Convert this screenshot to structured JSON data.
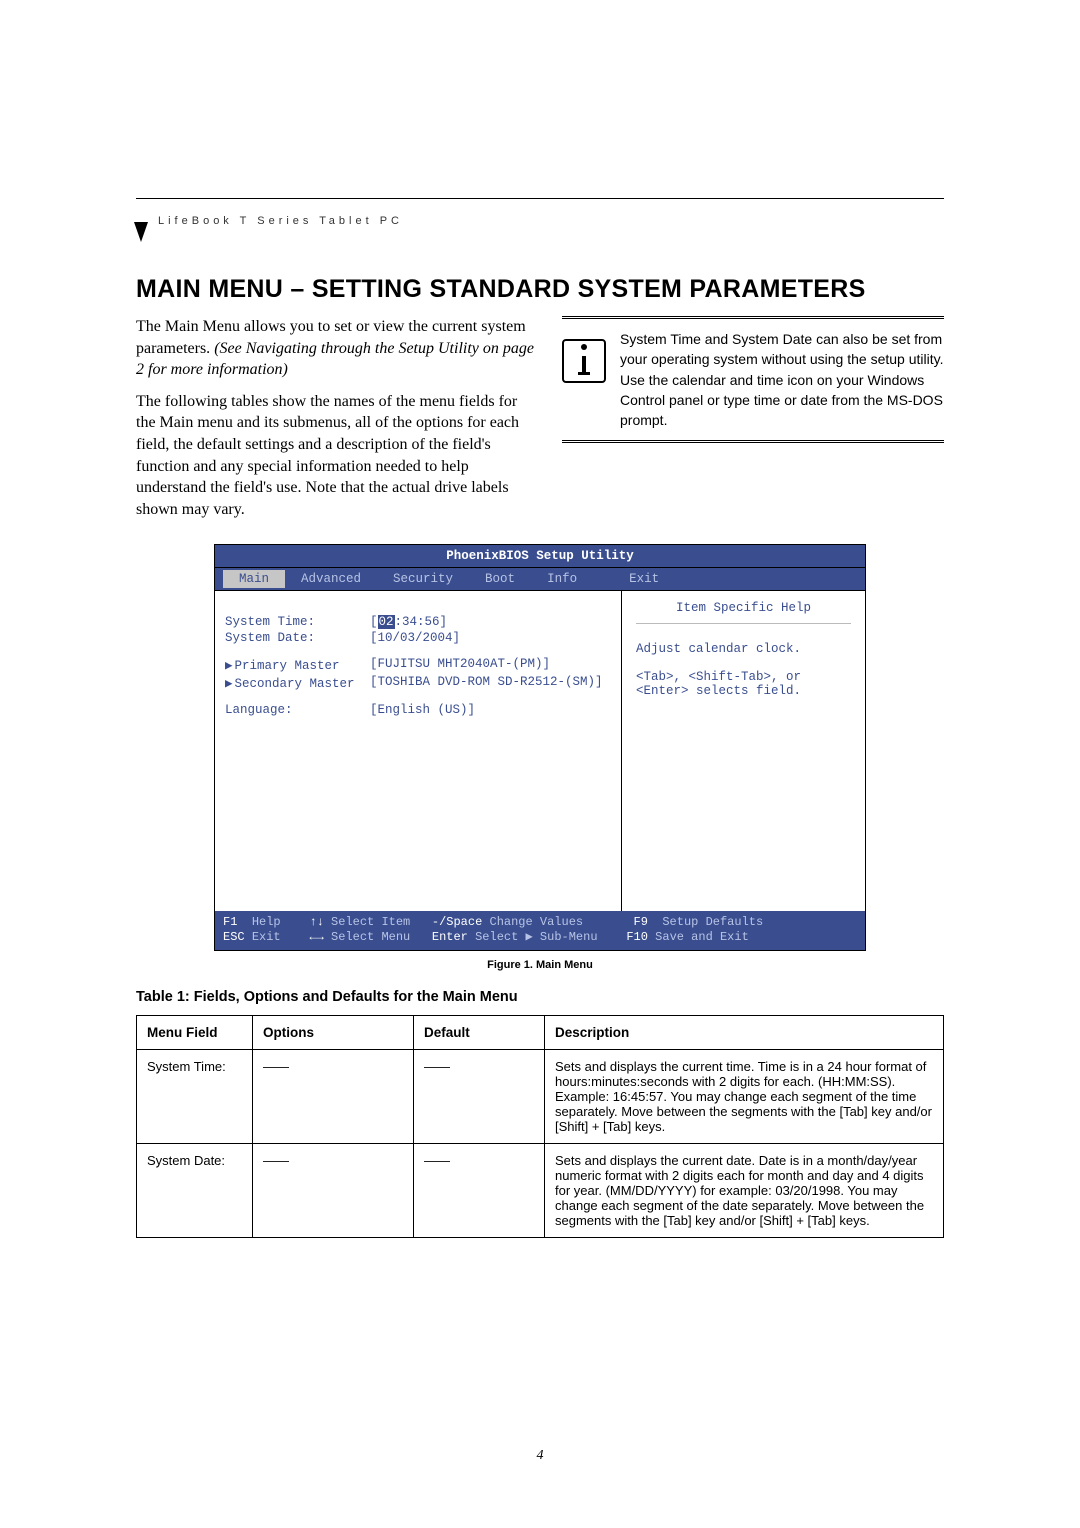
{
  "header_label": "LifeBook T Series Tablet PC",
  "title": "MAIN MENU – SETTING STANDARD SYSTEM PARAMETERS",
  "intro_para_1a": "The Main Menu allows you to set or view the current system parameters. ",
  "intro_para_1b": "(See Navigating through the Setup Utility on page 2 for more information)",
  "intro_para_2": "The following tables show the names of the menu fields for the Main menu and its submenus, all of the options for each field, the default settings and a description of the field's function and any special information needed to help understand the field's use. Note that the actual drive labels shown may vary.",
  "note_text": "System Time and System Date can also be set from your operating system without using the setup utility. Use the calendar and time icon on your Windows Control panel or type time or date from the MS-DOS prompt.",
  "bios": {
    "title": "PhoenixBIOS Setup Utility",
    "tabs": [
      "Main",
      "Advanced",
      "Security",
      "Boot",
      "Info",
      "Exit"
    ],
    "active_tab": "Main",
    "rows": {
      "system_time_label": "System Time:",
      "system_time_val_hl": "02",
      "system_time_val_rest": ":34:56]",
      "system_date_label": "System Date:",
      "system_date_val": "[10/03/2004]",
      "primary_label": "Primary Master",
      "primary_val": "[FUJITSU MHT2040AT-(PM)]",
      "secondary_label": "Secondary Master",
      "secondary_val": "[TOSHIBA DVD-ROM SD-R2512-(SM)]",
      "language_label": "Language:",
      "language_val": "[English (US)]"
    },
    "help_title": "Item Specific Help",
    "help_line1": "Adjust calendar clock.",
    "help_line2": "<Tab>, <Shift-Tab>, or",
    "help_line3": "<Enter> selects field.",
    "footer_line1_a": "F1",
    "footer_line1_b": "Help",
    "footer_line1_c": "↑↓",
    "footer_line1_d": "Select Item",
    "footer_line1_e": "-/Space",
    "footer_line1_f": "Change Values",
    "footer_line1_g": "F9",
    "footer_line1_h": "Setup Defaults",
    "footer_line2_a": "ESC",
    "footer_line2_b": "Exit",
    "footer_line2_c": "←→",
    "footer_line2_d": "Select Menu",
    "footer_line2_e": "Enter",
    "footer_line2_f": "Select ▶ Sub-Menu",
    "footer_line2_g": "F10",
    "footer_line2_h": "Save and Exit"
  },
  "figure_caption": "Figure 1.    Main Menu",
  "table_title": "Table 1: Fields, Options and Defaults for the Main Menu",
  "table": {
    "headers": [
      "Menu Field",
      "Options",
      "Default",
      "Description"
    ],
    "rows": [
      {
        "field": "System Time:",
        "options": "——",
        "default": "——",
        "desc": "Sets and displays the current time. Time is in a 24 hour format of hours:minutes:seconds with 2 digits for each. (HH:MM:SS). Example: 16:45:57. You may change each segment of the time separately. Move between the segments with the [Tab] key and/or [Shift] + [Tab] keys."
      },
      {
        "field": "System Date:",
        "options": "——",
        "default": "——",
        "desc": "Sets and displays the current date. Date is in a month/day/year numeric format with 2 digits each for month and day and 4 digits for year. (MM/DD/YYYY) for example: 03/20/1998. You may change each segment of the date separately. Move between the segments with the [Tab] key and/or [Shift] + [Tab] keys."
      }
    ]
  },
  "page_number": "4"
}
